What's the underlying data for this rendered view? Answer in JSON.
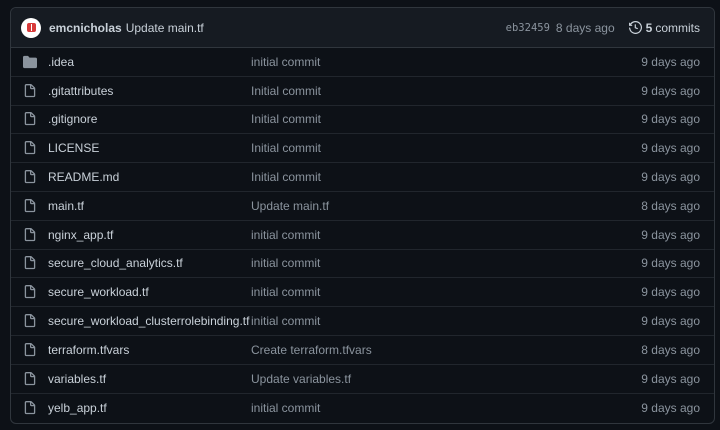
{
  "latest_commit": {
    "author": "emcnicholas",
    "message": "Update main.tf",
    "sha": "eb32459",
    "time": "8 days ago",
    "commit_count": "5",
    "commits_label": "commits"
  },
  "files": [
    {
      "name": ".idea",
      "type": "folder",
      "message": "initial commit",
      "age": "9 days ago"
    },
    {
      "name": ".gitattributes",
      "type": "file",
      "message": "Initial commit",
      "age": "9 days ago"
    },
    {
      "name": ".gitignore",
      "type": "file",
      "message": "Initial commit",
      "age": "9 days ago"
    },
    {
      "name": "LICENSE",
      "type": "file",
      "message": "Initial commit",
      "age": "9 days ago"
    },
    {
      "name": "README.md",
      "type": "file",
      "message": "Initial commit",
      "age": "9 days ago"
    },
    {
      "name": "main.tf",
      "type": "file",
      "message": "Update main.tf",
      "age": "8 days ago"
    },
    {
      "name": "nginx_app.tf",
      "type": "file",
      "message": "initial commit",
      "age": "9 days ago"
    },
    {
      "name": "secure_cloud_analytics.tf",
      "type": "file",
      "message": "initial commit",
      "age": "9 days ago"
    },
    {
      "name": "secure_workload.tf",
      "type": "file",
      "message": "initial commit",
      "age": "9 days ago"
    },
    {
      "name": "secure_workload_clusterrolebinding.tf",
      "type": "file",
      "message": "initial commit",
      "age": "9 days ago"
    },
    {
      "name": "terraform.tfvars",
      "type": "file",
      "message": "Create terraform.tfvars",
      "age": "8 days ago"
    },
    {
      "name": "variables.tf",
      "type": "file",
      "message": "Update variables.tf",
      "age": "9 days ago"
    },
    {
      "name": "yelb_app.tf",
      "type": "file",
      "message": "initial commit",
      "age": "9 days ago"
    }
  ],
  "colors": {
    "background": "#0d1117",
    "header_bg": "#161b22",
    "border": "#30363d",
    "text": "#c9d1d9",
    "muted": "#8b949e",
    "folder_icon": "#8b949e"
  }
}
